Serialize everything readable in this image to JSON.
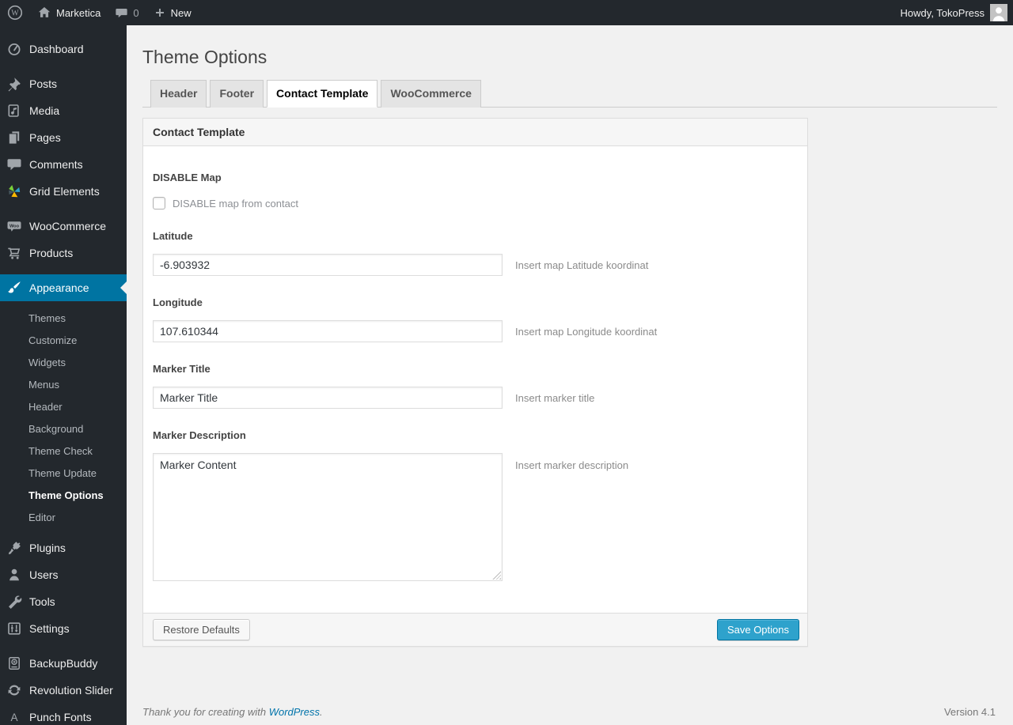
{
  "colors": {
    "admin_bar_bg": "#23282d",
    "sidebar_bg": "#23282d",
    "accent_active": "#0074a2",
    "primary_button": "#2ea2cc",
    "link": "#0073aa",
    "content_bg": "#f1f1f1"
  },
  "icons": {
    "wp_logo_letter": "W",
    "woo_badge_text": "Woo",
    "punch_fonts_glyph": "A",
    "map": {
      "wordpress-logo-icon": "W in circle",
      "home-icon": "house",
      "comments-bubble-icon": "speech bubble",
      "plus-icon": "plus sign",
      "gauge-icon": "dashboard gauge",
      "pin-icon": "pushpin",
      "media-icon": "framed music note",
      "pages-icon": "stacked pages",
      "speech-bubble-icon": "speech bubble",
      "pinwheel-icon": "colored pinwheel",
      "woo-badge-icon": "Woo speech badge",
      "cart-icon": "shopping cart",
      "brush-icon": "paint brush",
      "plug-icon": "power plug",
      "person-icon": "user silhouette",
      "wrench-icon": "wrench",
      "sliders-icon": "settings sliders panel",
      "backup-drive-icon": "drive with plus circle",
      "cycle-arrows-icon": "circular arrows",
      "letter-a-icon": "capital letter A",
      "avatar": "gray person avatar"
    }
  },
  "admin_bar": {
    "site_name": "Marketica",
    "comment_count": "0",
    "new_label": "New",
    "howdy": "Howdy, TokoPress"
  },
  "sidebar": {
    "items": [
      {
        "label": "Dashboard",
        "icon": "gauge-icon"
      },
      {
        "label": "Posts",
        "icon": "pin-icon"
      },
      {
        "label": "Media",
        "icon": "media-icon"
      },
      {
        "label": "Pages",
        "icon": "pages-icon"
      },
      {
        "label": "Comments",
        "icon": "speech-bubble-icon"
      },
      {
        "label": "Grid Elements",
        "icon": "pinwheel-icon"
      },
      {
        "label": "WooCommerce",
        "icon": "woo-badge-icon"
      },
      {
        "label": "Products",
        "icon": "cart-icon"
      },
      {
        "label": "Appearance",
        "icon": "brush-icon",
        "active": true
      },
      {
        "label": "Plugins",
        "icon": "plug-icon"
      },
      {
        "label": "Users",
        "icon": "person-icon"
      },
      {
        "label": "Tools",
        "icon": "wrench-icon"
      },
      {
        "label": "Settings",
        "icon": "sliders-icon"
      },
      {
        "label": "BackupBuddy",
        "icon": "backup-drive-icon"
      },
      {
        "label": "Revolution Slider",
        "icon": "cycle-arrows-icon"
      },
      {
        "label": "Punch Fonts",
        "icon": "letter-a-icon"
      }
    ],
    "appearance_submenu": [
      "Themes",
      "Customize",
      "Widgets",
      "Menus",
      "Header",
      "Background",
      "Theme Check",
      "Theme Update",
      "Theme Options",
      "Editor"
    ],
    "current_submenu_item": "Theme Options"
  },
  "page": {
    "title": "Theme Options",
    "tabs": [
      {
        "label": "Header",
        "active": false
      },
      {
        "label": "Footer",
        "active": false
      },
      {
        "label": "Contact Template",
        "active": true
      },
      {
        "label": "WooCommerce",
        "active": false
      }
    ]
  },
  "panel": {
    "header": "Contact Template",
    "fields": {
      "disable_map": {
        "label": "DISABLE Map",
        "checkbox_label": "DISABLE map from contact",
        "checked": false
      },
      "latitude": {
        "label": "Latitude",
        "value": "-6.903932",
        "hint": "Insert map Latitude koordinat"
      },
      "longitude": {
        "label": "Longitude",
        "value": "107.610344",
        "hint": "Insert map Longitude koordinat"
      },
      "marker_title": {
        "label": "Marker Title",
        "value": "Marker Title",
        "hint": "Insert marker title"
      },
      "marker_description": {
        "label": "Marker Description",
        "value": "Marker Content",
        "hint": "Insert marker description"
      }
    },
    "buttons": {
      "restore": "Restore Defaults",
      "save": "Save Options"
    }
  },
  "footer": {
    "thanks_prefix": "Thank you for creating with ",
    "thanks_link": "WordPress",
    "thanks_suffix": ".",
    "version": "Version 4.1"
  }
}
